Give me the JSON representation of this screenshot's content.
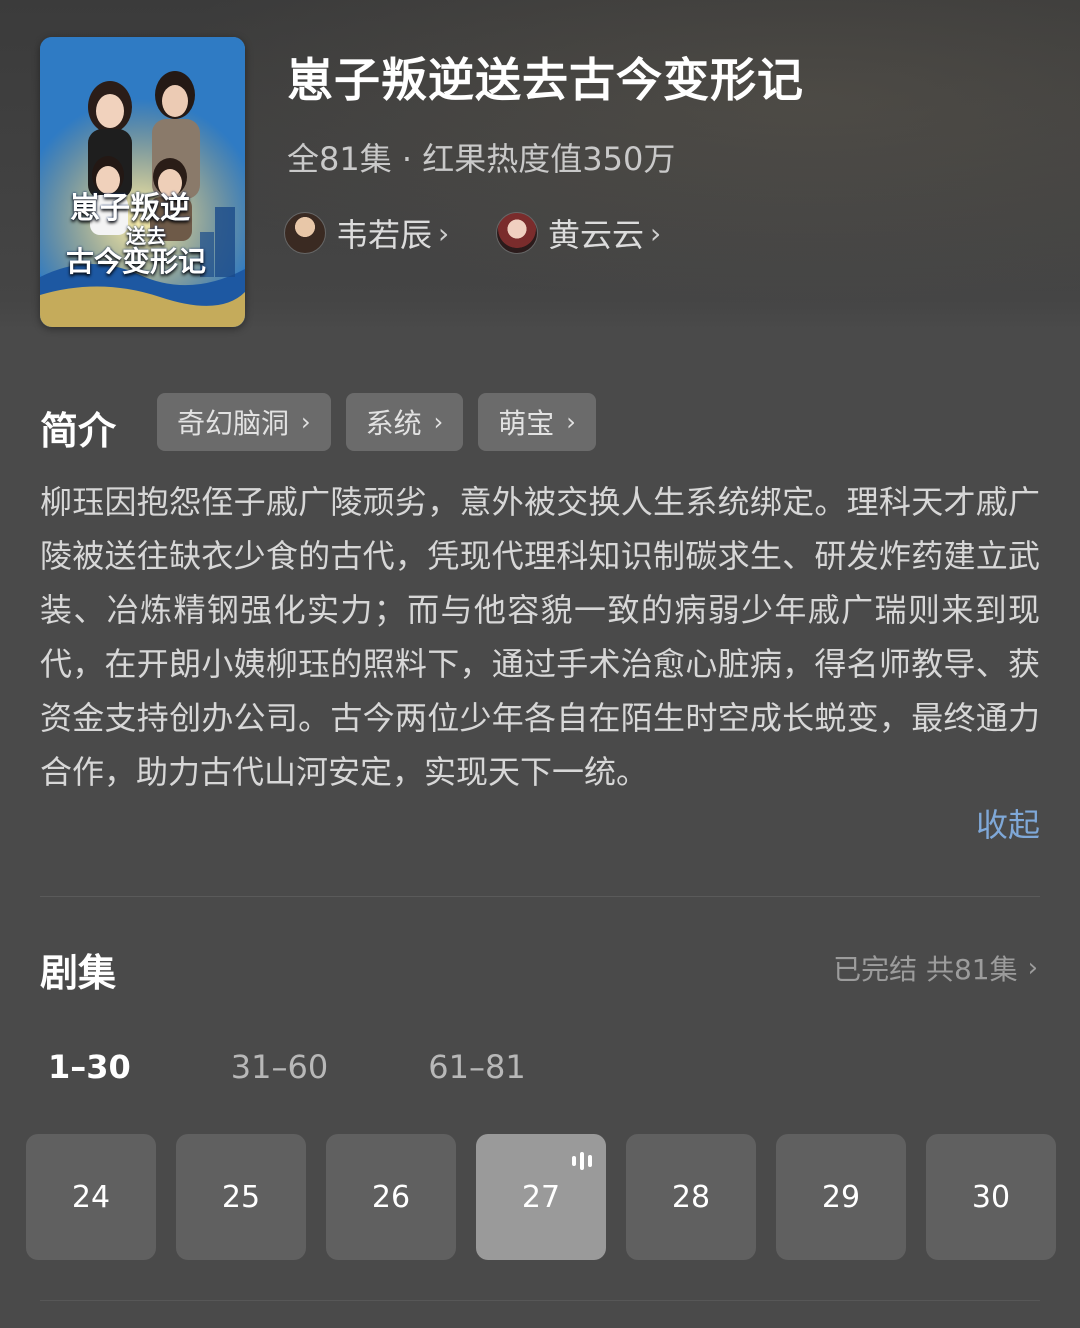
{
  "drama": {
    "title": "崽子叛逆送去古今变形记",
    "meta": "全81集 · 红果热度值350万",
    "cast": [
      {
        "name": "韦若辰",
        "chevron": "›"
      },
      {
        "name": "黄云云",
        "chevron": "›"
      }
    ],
    "poster_title": [
      "崽子叛逆",
      "送去",
      "古今变形记"
    ]
  },
  "intro": {
    "label": "简介",
    "tags": [
      {
        "label": "奇幻脑洞",
        "chevron": "›"
      },
      {
        "label": "系统",
        "chevron": "›"
      },
      {
        "label": "萌宝",
        "chevron": "›"
      }
    ],
    "description": "柳珏因抱怨侄子戚广陵顽劣，意外被交换人生系统绑定。理科天才戚广陵被送往缺衣少食的古代，凭现代理科知识制碳求生、研发炸药建立武装、冶炼精钢强化实力；而与他容貌一致的病弱少年戚广瑞则来到现代，在开朗小姨柳珏的照料下，通过手术治愈心脏病，得名师教导、获资金支持创办公司。古今两位少年各自在陌生时空成长蜕变，最终通力合作，助力古代山河安定，实现天下一统。",
    "collapse_label": "收起"
  },
  "episodes": {
    "label": "剧集",
    "status": "已完结 共81集",
    "status_chevron": "›",
    "ranges": [
      "1–30",
      "31–60",
      "61–81"
    ],
    "active_range": 0,
    "visible": [
      "24",
      "25",
      "26",
      "27",
      "28",
      "29",
      "30"
    ],
    "current": "27"
  },
  "colors": {
    "background": "#4a4a4a",
    "tag_bg": "#6b6b6b",
    "episode_bg": "#606060",
    "episode_current_bg": "#9a9a9a",
    "link": "#7fa8d8"
  },
  "icons": {
    "chevron": "chevron-right-icon",
    "playing": "playing-bars-icon"
  }
}
